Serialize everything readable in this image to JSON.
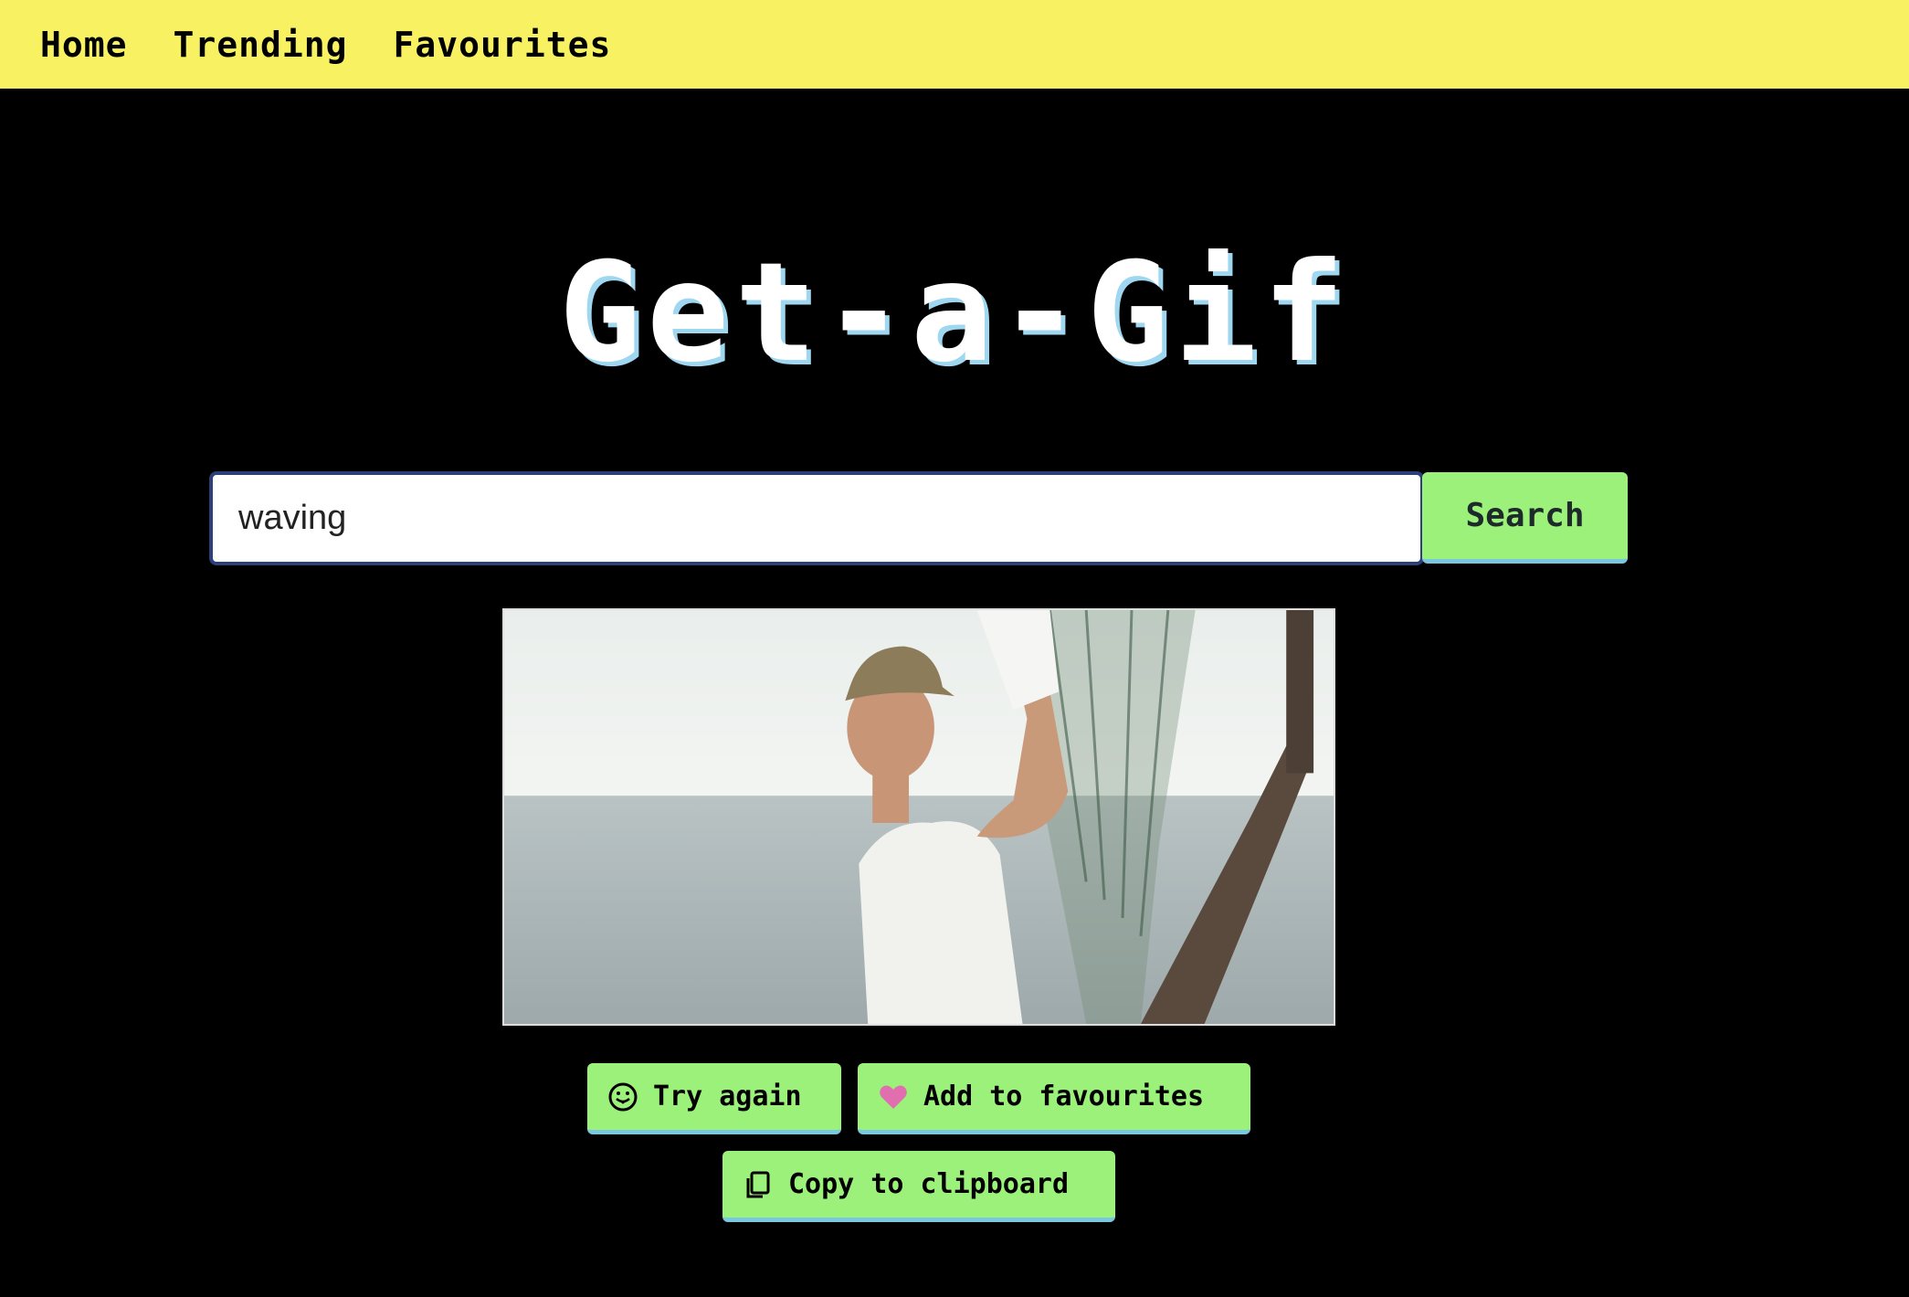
{
  "nav": {
    "items": [
      "Home",
      "Trending",
      "Favourites"
    ]
  },
  "header": {
    "title": "Get-a-Gif"
  },
  "search": {
    "value": "waving",
    "button_label": "Search"
  },
  "actions": {
    "try_again_label": "Try again",
    "try_again_icon": "grinning-tongue-icon",
    "add_fav_label": "Add to favourites",
    "add_fav_icon": "heart-icon",
    "copy_label": "Copy to clipboard",
    "copy_icon": "clipboard-copy-icon"
  },
  "colors": {
    "nav_bg": "#f8f162",
    "page_bg": "#000000",
    "button_bg": "#9bf17a",
    "button_accent": "#7ac8e0",
    "heart": "#e16fb0",
    "title_shadow": "#9fd7f0"
  }
}
